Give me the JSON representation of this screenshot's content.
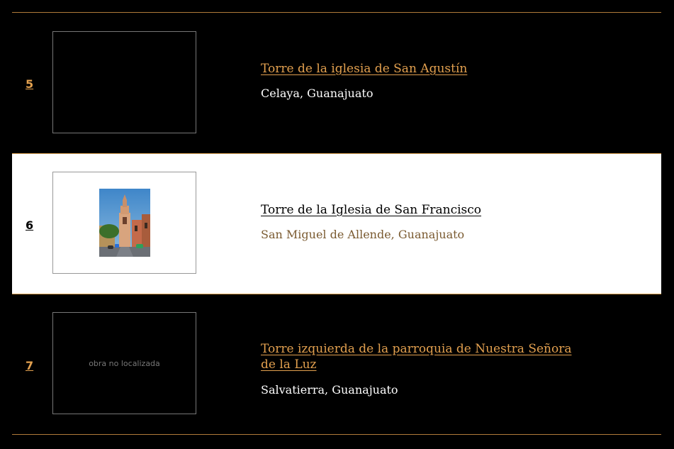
{
  "items": [
    {
      "number": "5",
      "title": "Torre de la iglesia de San Agustín",
      "place": "Celaya, Guanajuato",
      "thumb_note": ""
    },
    {
      "number": "6",
      "title": "Torre de la Iglesia de San Francisco",
      "place": "San Miguel de Allende, Guanajuato",
      "thumb_note": ""
    },
    {
      "number": "7",
      "title": "Torre izquierda de la parroquia de Nuestra Señora de la Luz",
      "place": "Salvatierra, Guanajuato",
      "thumb_note": "obra no localizada"
    }
  ],
  "colors": {
    "accent": "#e2a04f",
    "background": "#000000",
    "highlight_bg": "#ffffff",
    "place_highlight": "#7a5a30"
  }
}
